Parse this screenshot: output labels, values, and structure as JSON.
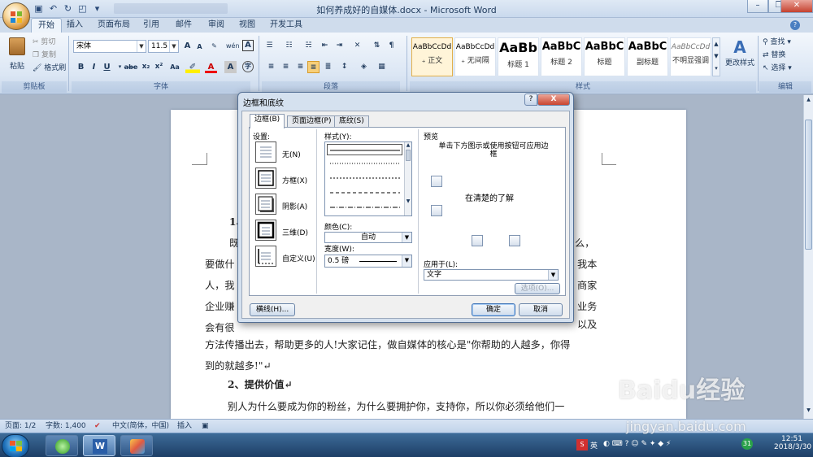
{
  "titlebar": {
    "title": "如何养成好的自媒体.docx - Microsoft Word"
  },
  "tabs": [
    "开始",
    "插入",
    "页面布局",
    "引用",
    "邮件",
    "审阅",
    "视图",
    "开发工具"
  ],
  "clipboard": {
    "paste": "粘贴",
    "cut": "剪切",
    "copy": "复制",
    "format_painter": "格式刷",
    "label": "剪贴板"
  },
  "font": {
    "name": "宋体",
    "size": "11.5",
    "label": "字体",
    "grow": "A",
    "shrink": "A",
    "wen": "wén",
    "bold": "B",
    "italic": "I",
    "underline": "U",
    "strike": "abe",
    "sub": "x₂",
    "sup": "x²",
    "aa": "Aa"
  },
  "paragraph": {
    "label": "段落"
  },
  "styles": {
    "label": "样式",
    "items": [
      {
        "sample": "AaBbCcDd",
        "name": "₊ 正文"
      },
      {
        "sample": "AaBbCcDd",
        "name": "₊ 无间隔"
      },
      {
        "sample": "AaBb",
        "name": "标题 1"
      },
      {
        "sample": "AaBbC",
        "name": "标题 2"
      },
      {
        "sample": "AaBbC",
        "name": "标题"
      },
      {
        "sample": "AaBbC",
        "name": "副标题"
      },
      {
        "sample": "AaBbCcDd",
        "name": "不明显强调"
      }
    ],
    "change": "更改样式"
  },
  "editing": {
    "find": "查找 ▾",
    "replace": "替换",
    "select": "选择 ▾",
    "label": "编辑"
  },
  "document": {
    "lines": [
      "1、",
      "既",
      "要做什",
      "人，我",
      "企业赚",
      "会有很",
      "方法传播出去，帮助更多的人!大家记住，做自媒体的核心是\"你帮助的人越多，你得",
      "到的就越多!\"↵",
      "2、提供价值↵",
      "别人为什么要成为你的粉丝，为什么要拥护你，支持你，所以你必须给他们一"
    ],
    "right_fragments": [
      "么，",
      "我本",
      "商家",
      "业务",
      "以及"
    ]
  },
  "dialog": {
    "title": "边框和底纹",
    "help": "?",
    "close": "X",
    "tabs": [
      "边框(B)",
      "页面边框(P)",
      "底纹(S)"
    ],
    "settings_label": "设置:",
    "settings": [
      "无(N)",
      "方框(X)",
      "阴影(A)",
      "三维(D)",
      "自定义(U)"
    ],
    "style_label": "样式(Y):",
    "color_label": "颜色(C):",
    "color_value": "自动",
    "width_label": "宽度(W):",
    "width_value": "0.5 磅",
    "preview_label": "预览",
    "preview_hint": "单击下方图示或使用按钮可应用边框",
    "preview_text": "在清楚的了解",
    "apply_label": "应用于(L):",
    "apply_value": "文字",
    "options": "选项(O)...",
    "hline": "横线(H)...",
    "ok": "确定",
    "cancel": "取消"
  },
  "status": {
    "page": "页面: 1/2",
    "words": "字数: 1,400",
    "lang": "中文(简体，中国)",
    "mode": "插入"
  },
  "tray": {
    "time": "12:51",
    "date": "2018/3/30",
    "ime": "英",
    "badge": "31"
  },
  "watermark": {
    "brand": "Baidu经验",
    "url": "jingyan.baidu.com"
  }
}
